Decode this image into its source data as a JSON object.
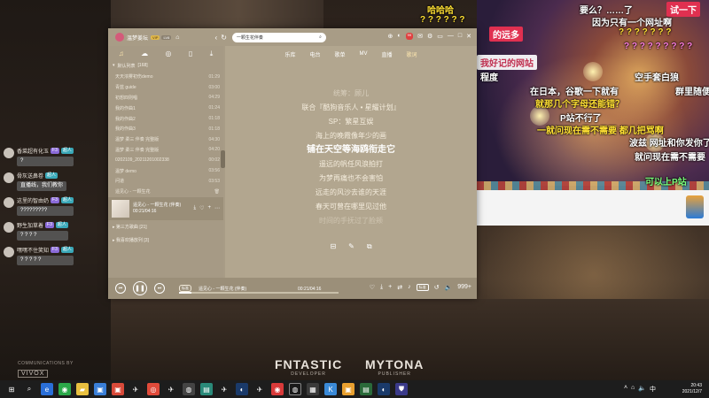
{
  "danmaku": [
    {
      "text": "哈哈哈",
      "style": "dm-yellow"
    },
    {
      "text": "? ? ? ? ? ?",
      "style": "dm-yellow"
    },
    {
      "text": "的远多",
      "style": "dm-red-bg"
    },
    {
      "text": "要么？……了",
      "style": ""
    },
    {
      "text": "试一下",
      "style": "dm-red-bg"
    },
    {
      "text": "因为只有一个网址啊",
      "style": ""
    },
    {
      "text": "? ? ? ? ? ? ?",
      "style": "dm-yellow"
    },
    {
      "text": "? ? ? ? ? ? ? ? ?",
      "style": "dm-pink"
    },
    {
      "text": "我好记的网站",
      "style": "dm-white-bg"
    },
    {
      "text": "程度",
      "style": ""
    },
    {
      "text": "空手套白狼",
      "style": ""
    },
    {
      "text": "在日本，谷歌一下就有",
      "style": ""
    },
    {
      "text": "群里随便",
      "style": ""
    },
    {
      "text": "就那几个字母还能错？",
      "style": "dm-yellow"
    },
    {
      "text": "P站不行了",
      "style": ""
    },
    {
      "text": "一就问现在需不需要 都几把骂啊",
      "style": "dm-yellow"
    },
    {
      "text": "波兹 网址和你发你了",
      "style": ""
    },
    {
      "text": "就问现在需不需要",
      "style": ""
    },
    {
      "text": "可以上P站",
      "style": "dm-green"
    }
  ],
  "chat": [
    {
      "name": "香菜超有化玉",
      "tag": "F3",
      "tag2": "超人",
      "msg": "?"
    },
    {
      "name": "骨灰送鼻卷",
      "tag": "",
      "tag2": "超人",
      "msg": "直播线，我们教你"
    },
    {
      "name": "这里的智由奶",
      "tag": "F3",
      "tag2": "超人",
      "msg": "?????????"
    },
    {
      "name": "野生加草着",
      "tag": "F3",
      "tag2": "超人",
      "msg": "? ? ? ?"
    },
    {
      "name": "嘿嘿不住笑知",
      "tag": "F3",
      "tag2": "超人",
      "msg": "? ? ? ? ?"
    }
  ],
  "credits": "COMMUNICATIONS BY",
  "vivox": "VIVOX",
  "brand1": {
    "name": "FNTASTIC",
    "sub": "DEVELOPER"
  },
  "brand2": {
    "name": "MYTONA",
    "sub": "PUBLISHER"
  },
  "player": {
    "user": "温梦姜坛",
    "vip": "VIP",
    "level": "LV8",
    "search_value": "一颗生花伴奏",
    "section_default": "默认列表",
    "section_count": "[168]",
    "songs": [
      {
        "title": "天天浓雾初伤demo",
        "dur": "01:29"
      },
      {
        "title": "青蓝 guide",
        "dur": "03:00"
      },
      {
        "title": "初想四则唱",
        "dur": "04:29"
      },
      {
        "title": "我的作曲1",
        "dur": "01:24"
      },
      {
        "title": "我的作曲2",
        "dur": "01:18"
      },
      {
        "title": "我的作曲3",
        "dur": "01:18"
      },
      {
        "title": "温梦 柔三 伴奏 完整版",
        "dur": "04:30"
      },
      {
        "title": "温梦 柔三 伴奏 完整版",
        "dur": "04:20"
      },
      {
        "title": "0202109_20211201002338",
        "dur": "00:02"
      },
      {
        "title": "温梦 demo",
        "dur": "03:56"
      },
      {
        "title": "问道",
        "dur": "03:53"
      },
      {
        "title": "遥见心 - 一颗生花",
        "dur": ""
      }
    ],
    "now_title": "遥见心 - 一颗生花 (伴奏)",
    "now_time": "00:21/04:16",
    "group_third": "第三方歌曲",
    "group_third_count": "[21]",
    "group_favorite": "我喜欢播放列",
    "group_favorite_count": "[3]",
    "tabs": [
      "乐库",
      "电台",
      "歌单",
      "MV",
      "直播",
      "歌词"
    ],
    "lyrics": [
      {
        "text": "统筹：顾儿",
        "cls": "dim"
      },
      {
        "text": "联合『酷狗音乐人 • 星耀计划』",
        "cls": ""
      },
      {
        "text": "SP：繁星互娱",
        "cls": ""
      },
      {
        "text": "海上的晚霞像年少的画",
        "cls": ""
      },
      {
        "text": "铺在天空等海鸥衔走它",
        "cls": "current"
      },
      {
        "text": "遥远的帆任风浪拍打",
        "cls": ""
      },
      {
        "text": "为梦再痛也不会害怕",
        "cls": ""
      },
      {
        "text": "远走的风沙去谁的天涯",
        "cls": ""
      },
      {
        "text": "春天可曾在哪里见过他",
        "cls": ""
      },
      {
        "text": "时间的手抚过了脸颊",
        "cls": "fade"
      }
    ],
    "mode_label": "标准",
    "track_label": "遥见心 - 一颗生花 (伴奏)",
    "time": "00:21/04:16",
    "progress": 0.08,
    "quality": "标准",
    "count_label": "999+"
  },
  "taskbar_time": "20:43",
  "taskbar_date": "2021/12/7"
}
